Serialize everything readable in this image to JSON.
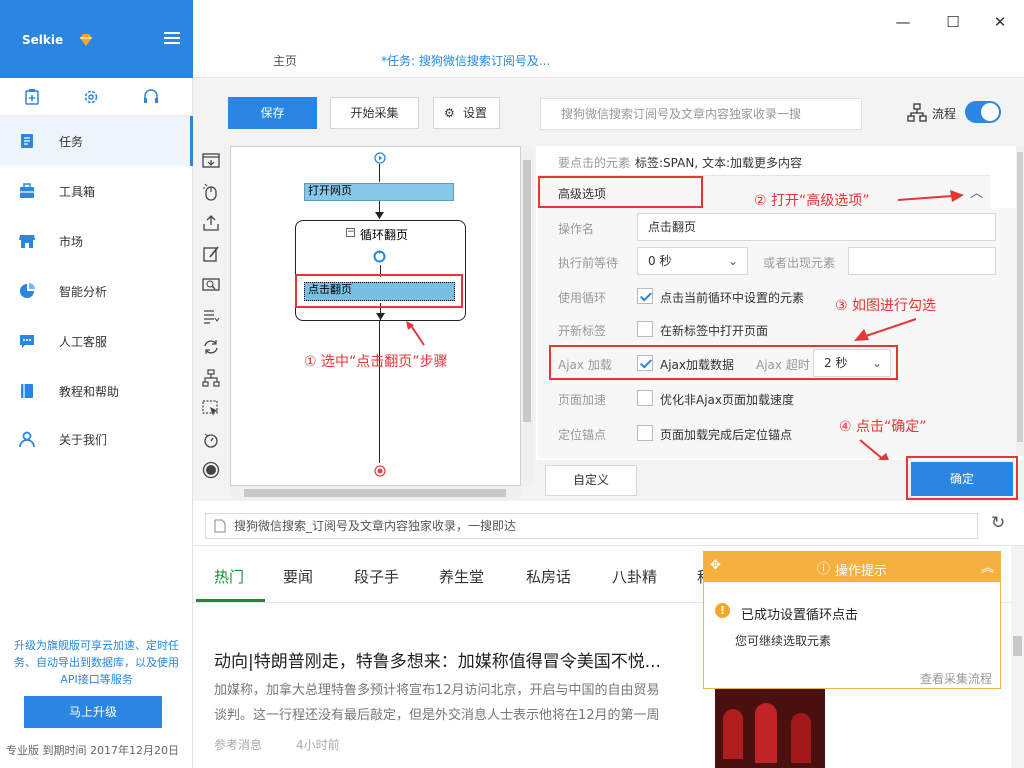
{
  "app": {
    "name": "Selkie",
    "tabs": [
      "主页",
      "*任务: 搜狗微信搜索订阅号及..."
    ]
  },
  "sidebar": {
    "nav": [
      {
        "label": "任务",
        "icon": "task-icon"
      },
      {
        "label": "工具箱",
        "icon": "toolbox-icon"
      },
      {
        "label": "市场",
        "icon": "store-icon"
      },
      {
        "label": "智能分析",
        "icon": "pie-chart-icon"
      },
      {
        "label": "人工客服",
        "icon": "chat-icon"
      },
      {
        "label": "教程和帮助",
        "icon": "book-icon"
      },
      {
        "label": "关于我们",
        "icon": "person-icon"
      }
    ],
    "promo": "升级为旗舰版可享云加速、定时任务、自动导出到数据库，以及使用API接口等服务",
    "upgrade_label": "马上升级",
    "license": "专业版  到期时间  2017年12月20日"
  },
  "toolbar": {
    "save_label": "保存",
    "start_label": "开始采集",
    "settings_label": "设置",
    "search_text": "搜狗微信搜索订阅号及文章内容独家收录一搜",
    "flow_label": "流程"
  },
  "flow": {
    "open_page": "打开网页",
    "loop_label": "循环翻页",
    "click_step": "点击翻页"
  },
  "props": {
    "target_label": "要点击的元素",
    "target_value": "标签:SPAN, 文本:加载更多内容",
    "advanced_label": "高级选项",
    "rows": {
      "op_name_label": "操作名",
      "op_name_value": "点击翻页",
      "wait_label": "执行前等待",
      "wait_value": "0 秒",
      "or_appear_label": "或者出现元素",
      "loop_label": "使用循环",
      "loop_text": "点击当前循环中设置的元素",
      "newtab_label": "开新标签",
      "newtab_text": "在新标签中打开页面",
      "ajax_label": "Ajax 加载",
      "ajax_text": "Ajax加载数据",
      "ajax_timeout_label": "Ajax 超时",
      "ajax_timeout_value": "2 秒",
      "speed_label": "页面加速",
      "speed_text": "优化非Ajax页面加载速度",
      "anchor_label": "定位锚点",
      "anchor_text": "页面加载完成后定位锚点"
    },
    "custom_label": "自定义",
    "confirm_label": "确定"
  },
  "annotations": {
    "a1": "① 选中“点击翻页”步骤",
    "a2": "② 打开“高级选项”",
    "a3": "③ 如图进行勾选",
    "a4": "④ 点击“确定”"
  },
  "browser": {
    "url_text": "搜狗微信搜索_订阅号及文章内容独家收录，一搜即达",
    "tabs": [
      "热门",
      "要闻",
      "段子手",
      "养生堂",
      "私房话",
      "八卦精",
      "科"
    ],
    "headline": "动向|特朗普刚走，特鲁多想来：加媒称值得冒令美国不悦...",
    "snippet1": "加媒称，加拿大总理特鲁多预计将宣布12月访问北京，开启与中国的自由贸易",
    "snippet2": "谈判。这一行程还没有最后敲定，但是外交消息人士表示他将在12月的第一周",
    "source": "参考消息",
    "time": "4小时前"
  },
  "hint": {
    "title": "操作提示",
    "message": "已成功设置循环点击",
    "sub": "您可继续选取元素",
    "link": "查看采集流程"
  },
  "colors": {
    "accent": "#2a86e0",
    "annotation": "#e63535",
    "hint": "#f5b03f",
    "green_tab": "#1a8c3a"
  }
}
